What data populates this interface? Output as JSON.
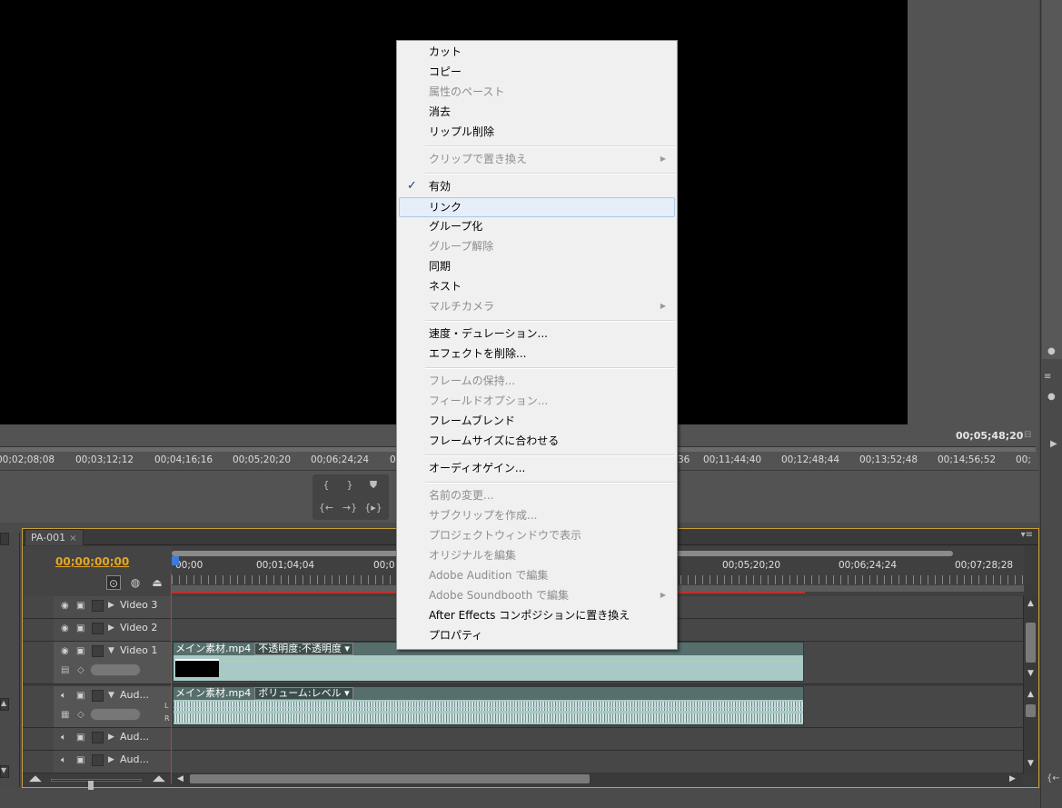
{
  "monitor": {
    "duration": "00;05;48;20",
    "ruler_ticks": [
      "00;02;08;08",
      "00;03;12;12",
      "00;04;16;16",
      "00;05;20;20",
      "00;06;24;24",
      "0",
      "36",
      "00;11;44;40",
      "00;12;48;44",
      "00;13;52;48",
      "00;14;56;52",
      "00;"
    ]
  },
  "timeline": {
    "tab_label": "PA-001",
    "tab_close": "×",
    "current_time": "00;00;00;00",
    "ruler_ticks": [
      "00;00",
      "00;01;04;04",
      "00;0",
      "00;05;20;20",
      "00;06;24;24",
      "00;07;28;28"
    ],
    "tracks": [
      {
        "name": "Video 3"
      },
      {
        "name": "Video 2"
      },
      {
        "name": "Video 1"
      },
      {
        "name": "Aud..."
      },
      {
        "name": "Aud..."
      },
      {
        "name": "Aud..."
      }
    ],
    "video_clip": {
      "name": "メイン素材.mp4",
      "effect": "不透明度:不透明度"
    },
    "audio_clip": {
      "name": "メイン素材.mp4",
      "effect": "ボリューム:レベル"
    },
    "audio_channels": [
      "L",
      "R"
    ]
  },
  "context_menu": {
    "items": [
      {
        "label": "カット"
      },
      {
        "label": "コピー"
      },
      {
        "label": "属性のペースト"
      },
      {
        "label": "消去"
      },
      {
        "label": "リップル削除"
      },
      {
        "label": "クリップで置き換え"
      },
      {
        "label": "有効",
        "check": "✓"
      },
      {
        "label": "リンク"
      },
      {
        "label": "グループ化"
      },
      {
        "label": "グループ解除"
      },
      {
        "label": "同期"
      },
      {
        "label": "ネスト"
      },
      {
        "label": "マルチカメラ"
      },
      {
        "label": "速度・デュレーション..."
      },
      {
        "label": "エフェクトを削除..."
      },
      {
        "label": "フレームの保持..."
      },
      {
        "label": "フィールドオプション..."
      },
      {
        "label": "フレームブレンド"
      },
      {
        "label": "フレームサイズに合わせる"
      },
      {
        "label": "オーディオゲイン..."
      },
      {
        "label": "名前の変更..."
      },
      {
        "label": "サブクリップを作成..."
      },
      {
        "label": "プロジェクトウィンドウで表示"
      },
      {
        "label": "オリジナルを編集"
      },
      {
        "label": "Adobe Audition で編集"
      },
      {
        "label": "Adobe Soundbooth で編集"
      },
      {
        "label": "After Effects コンポジションに置き換え"
      },
      {
        "label": "プロパティ"
      }
    ]
  },
  "colors": {
    "timecode": "#e5a624",
    "clip": "#a8c9c6",
    "playhead": "#d03a2a",
    "menu_bg": "#f0f0f0"
  }
}
